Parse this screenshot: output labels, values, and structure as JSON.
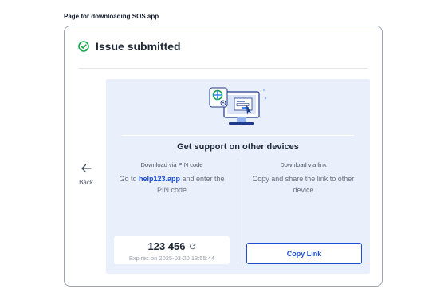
{
  "page": {
    "caption": "Page for downloading SOS app"
  },
  "header": {
    "title": "Issue submitted",
    "icon": "check-circle-icon",
    "icon_color": "#16a34a"
  },
  "back": {
    "label": "Back",
    "icon": "arrow-left-icon"
  },
  "panel": {
    "title": "Get support on other devices",
    "background": "#eaf0fb",
    "illustration_icon": "devices-illustration-icon"
  },
  "pin_section": {
    "heading": "Download via PIN code",
    "text_before": "Go to ",
    "link_text": "help123.app",
    "text_after": " and enter the PIN code",
    "pin": "123 456",
    "refresh_icon": "refresh-icon",
    "expires": "Expires on 2025-03-20 13:55:44"
  },
  "link_section": {
    "heading": "Download via link",
    "text": "Copy and share the link to other device",
    "button_label": "Copy Link"
  },
  "colors": {
    "accent": "#1d4ed8",
    "success": "#16a34a"
  }
}
